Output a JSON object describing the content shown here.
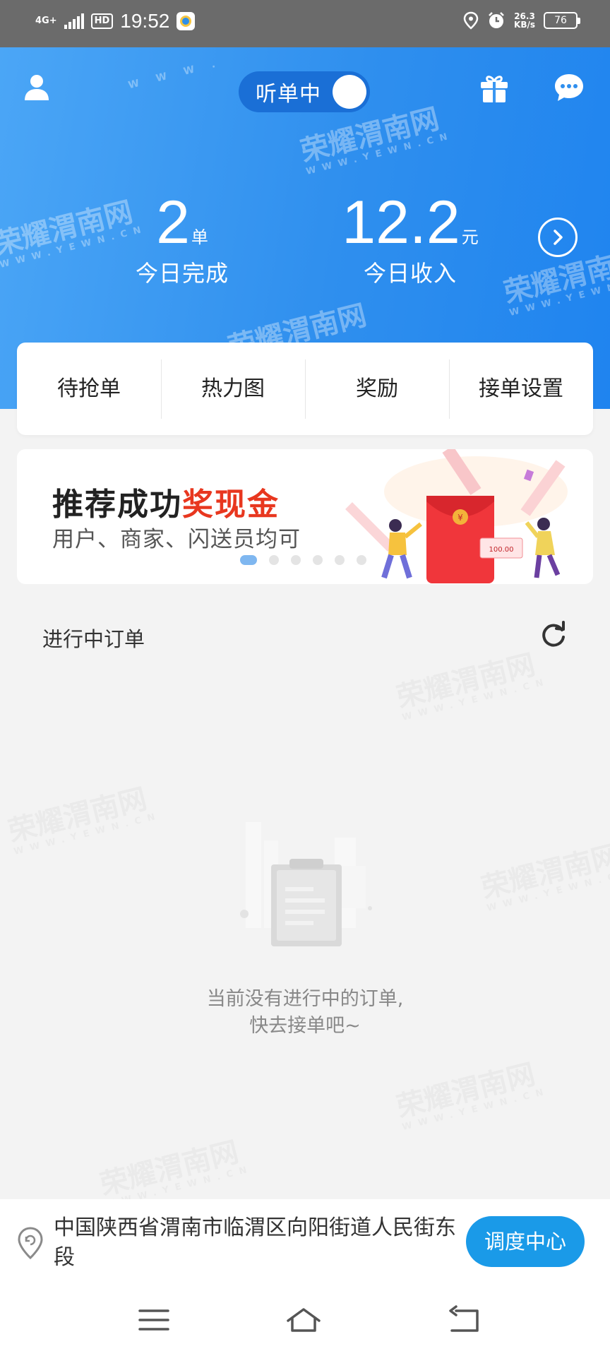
{
  "status_bar": {
    "network": "4G+",
    "hd": "HD",
    "time": "19:52",
    "speed_value": "26.3",
    "speed_unit": "KB/s",
    "battery": "76"
  },
  "header": {
    "listen_label": "听单中",
    "listen_on": true,
    "orders_count": "2",
    "orders_unit": "单",
    "orders_caption": "今日完成",
    "income_value": "12.2",
    "income_unit": "元",
    "income_caption": "今日收入"
  },
  "menu": {
    "items": [
      {
        "label": "待抢单"
      },
      {
        "label": "热力图"
      },
      {
        "label": "奖励"
      },
      {
        "label": "接单设置"
      }
    ]
  },
  "banner": {
    "title_main": "推荐成功",
    "title_highlight": "奖现金",
    "subtitle": "用户、商家、闪送员均可",
    "envelope_amount": "100.00",
    "page_count": 6,
    "active_page": 0,
    "highlight_color": "#e8371f"
  },
  "orders": {
    "section_title": "进行中订单",
    "empty_line1": "当前没有进行中的订单,",
    "empty_line2": "快去接单吧~"
  },
  "location": {
    "address": "中国陕西省渭南市临渭区向阳街道人民街东段",
    "dispatch_label": "调度中心"
  },
  "watermark": {
    "text": "荣耀渭南网",
    "sub": "WWW.YEWN.CN"
  },
  "colors": {
    "header_blue": "#2f8fee",
    "toggle_dark": "#1a6fd6",
    "dispatch_blue": "#1a9ae8",
    "indicator_active": "#7fb7f0"
  },
  "icons": {
    "user": "user-icon",
    "gift": "gift-icon",
    "message": "message-icon",
    "next": "chevron-right-icon",
    "refresh": "refresh-icon",
    "location": "location-pin-icon",
    "nav_menu": "menu-lines-icon",
    "nav_home": "home-icon",
    "nav_back": "back-icon"
  }
}
